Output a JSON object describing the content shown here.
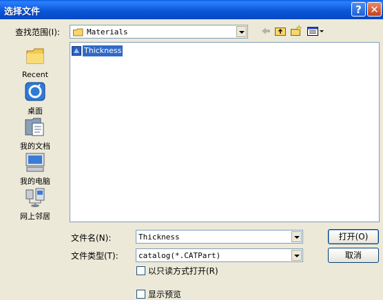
{
  "window": {
    "title": "选择文件"
  },
  "lookin": {
    "label": "查找范围(I):",
    "value": "Materials"
  },
  "places": [
    {
      "label": "Recent"
    },
    {
      "label": "桌面"
    },
    {
      "label": "我的文档"
    },
    {
      "label": "我的电脑"
    },
    {
      "label": "网上邻居"
    }
  ],
  "files": [
    {
      "name": "Thickness"
    }
  ],
  "filename": {
    "label": "文件名(N):",
    "value": "Thickness"
  },
  "filetype": {
    "label": "文件类型(T):",
    "value": "catalog(*.CATPart)"
  },
  "readonly": {
    "label": "以只读方式打开(R)"
  },
  "preview": {
    "label": "显示预览"
  },
  "buttons": {
    "open": "打开(O)",
    "cancel": "取消"
  },
  "colors": {
    "titlebar": "#0a58d8",
    "selection": "#316ac5",
    "dialog_bg": "#ece9d8"
  }
}
